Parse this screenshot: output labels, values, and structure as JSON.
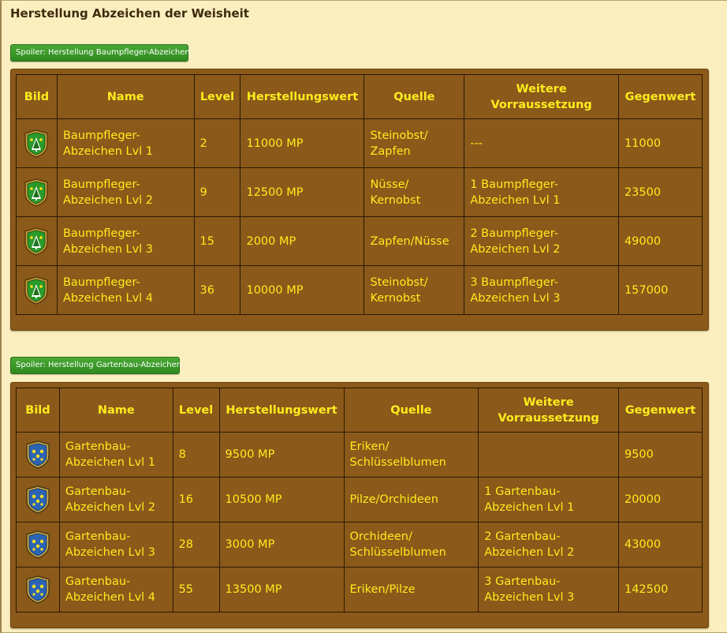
{
  "page": {
    "title": "Herstellung Abzeichen der Weisheit"
  },
  "colors": {
    "background": "#fcefbf",
    "panel": "#8b5919",
    "text_yellow": "#ffec1e",
    "spoiler_green": "#3b9a28",
    "green_shield": "#2a9a2a",
    "blue_shield": "#2c64b4"
  },
  "sections": [
    {
      "spoiler_label": "Spoiler: Herstellung Baumpfleger-Abzeichen",
      "icon": "tree-badge-icon",
      "headers": {
        "bild": "Bild",
        "name": "Name",
        "level": "Level",
        "herstellungswert": "Herstellungswert",
        "quelle": "Quelle",
        "weitere_1": "Weitere",
        "weitere_2": "Vorraussetzung",
        "gegenwert": "Gegenwert"
      },
      "rows": [
        {
          "name_1": "Baumpfleger-",
          "name_2": "Abzeichen Lvl 1",
          "level": "2",
          "herstellungswert": "11000 MP",
          "quelle_1": "Steinobst/",
          "quelle_2": "Zapfen",
          "weitere_1": "---",
          "weitere_2": "",
          "gegenwert": "11000"
        },
        {
          "name_1": "Baumpfleger-",
          "name_2": "Abzeichen Lvl 2",
          "level": "9",
          "herstellungswert": "12500 MP",
          "quelle_1": "Nüsse/",
          "quelle_2": "Kernobst",
          "weitere_1": "1 Baumpfleger-",
          "weitere_2": "Abzeichen Lvl 1",
          "gegenwert": "23500"
        },
        {
          "name_1": "Baumpfleger-",
          "name_2": "Abzeichen Lvl 3",
          "level": "15",
          "herstellungswert": "2000 MP",
          "quelle_1": "Zapfen/Nüsse",
          "quelle_2": "",
          "weitere_1": "2 Baumpfleger-",
          "weitere_2": "Abzeichen Lvl 2",
          "gegenwert": "49000"
        },
        {
          "name_1": "Baumpfleger-",
          "name_2": "Abzeichen Lvl 4",
          "level": "36",
          "herstellungswert": "10000 MP",
          "quelle_1": "Steinobst/",
          "quelle_2": "Kernobst",
          "weitere_1": "3 Baumpfleger-",
          "weitere_2": "Abzeichen Lvl 3",
          "gegenwert": "157000"
        }
      ]
    },
    {
      "spoiler_label": "Spoiler: Herstellung Gartenbau-Abzeichen",
      "icon": "flower-badge-icon",
      "headers": {
        "bild": "Bild",
        "name": "Name",
        "level": "Level",
        "herstellungswert": "Herstellungswert",
        "quelle": "Quelle",
        "weitere_1": "Weitere",
        "weitere_2": "Vorraussetzung",
        "gegenwert": "Gegenwert"
      },
      "rows": [
        {
          "name_1": "Gartenbau-",
          "name_2": "Abzeichen Lvl 1",
          "level": "8",
          "herstellungswert": "9500 MP",
          "quelle_1": "Eriken/",
          "quelle_2": "Schlüsselblumen",
          "weitere_1": "",
          "weitere_2": "",
          "gegenwert": "9500"
        },
        {
          "name_1": "Gartenbau-",
          "name_2": "Abzeichen Lvl 2",
          "level": "16",
          "herstellungswert": "10500 MP",
          "quelle_1": "Pilze/Orchideen",
          "quelle_2": "",
          "weitere_1": "1 Gartenbau-",
          "weitere_2": "Abzeichen Lvl 1",
          "gegenwert": "20000"
        },
        {
          "name_1": "Gartenbau-",
          "name_2": "Abzeichen Lvl 3",
          "level": "28",
          "herstellungswert": "3000 MP",
          "quelle_1": "Orchideen/",
          "quelle_2": "Schlüsselblumen",
          "weitere_1": "2 Gartenbau-",
          "weitere_2": "Abzeichen Lvl 2",
          "gegenwert": "43000"
        },
        {
          "name_1": "Gartenbau-",
          "name_2": "Abzeichen Lvl 4",
          "level": "55",
          "herstellungswert": "13500 MP",
          "quelle_1": "Eriken/Pilze",
          "quelle_2": "",
          "weitere_1": "3 Gartenbau-",
          "weitere_2": "Abzeichen Lvl 3",
          "gegenwert": "142500"
        }
      ]
    }
  ]
}
